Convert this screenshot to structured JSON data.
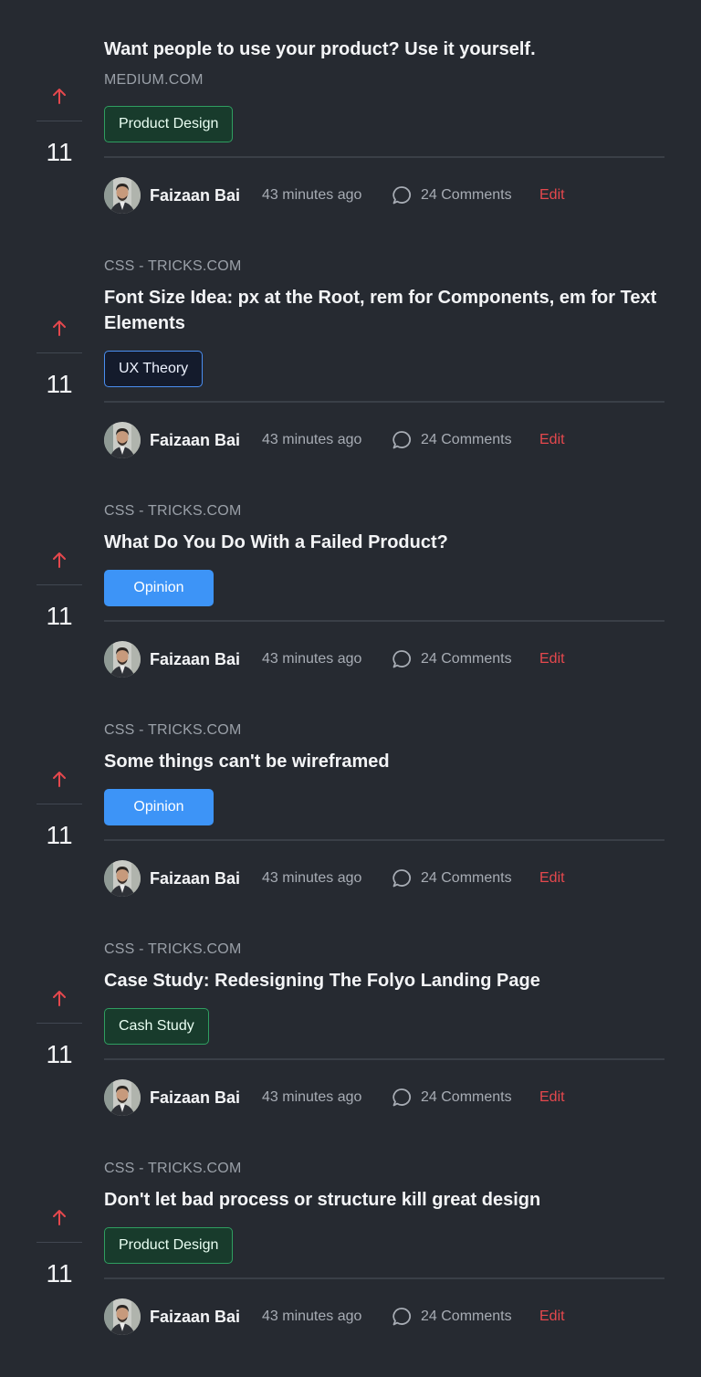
{
  "posts": [
    {
      "source": "MEDIUM.COM",
      "title": "Want people to use your product? Use it yourself.",
      "tag": "Product Design",
      "votes": "11",
      "author": "Faizaan Bai",
      "time": "43 minutes ago",
      "comments": "24 Comments",
      "edit": "Edit"
    },
    {
      "source": "CSS - TRICKS.COM",
      "title": "Font Size Idea: px at the Root, rem for Components, em for Text Elements",
      "tag": "UX Theory",
      "votes": "11",
      "author": "Faizaan Bai",
      "time": "43 minutes ago",
      "comments": "24 Comments",
      "edit": "Edit"
    },
    {
      "source": "CSS - TRICKS.COM",
      "title": "What Do You Do With a Failed Product?",
      "tag": "Opinion",
      "votes": "11",
      "author": "Faizaan Bai",
      "time": "43 minutes ago",
      "comments": "24 Comments",
      "edit": "Edit"
    },
    {
      "source": "CSS - TRICKS.COM",
      "title": "Some things can't be wireframed",
      "tag": "Opinion",
      "votes": "11",
      "author": "Faizaan Bai",
      "time": "43 minutes ago",
      "comments": "24 Comments",
      "edit": "Edit"
    },
    {
      "source": "CSS - TRICKS.COM",
      "title": "Case Study: Redesigning The Folyo Landing Page",
      "tag": "Cash Study",
      "votes": "11",
      "author": "Faizaan Bai",
      "time": "43 minutes ago",
      "comments": "24 Comments",
      "edit": "Edit"
    },
    {
      "source": "CSS - TRICKS.COM",
      "title": "Don't let bad process or structure kill great design",
      "tag": "Product Design",
      "votes": "11",
      "author": "Faizaan Bai",
      "time": "43 minutes ago",
      "comments": "24 Comments",
      "edit": "Edit"
    }
  ],
  "icons": {
    "upvote": "arrow-up-icon",
    "comments": "chat-bubble-icon",
    "avatar": "user-avatar"
  },
  "colors": {
    "background": "#262a31",
    "upvote": "#e5484d",
    "edit": "#e5484d",
    "tag_green": "#2f9e60",
    "tag_navy": "#4a8ef0",
    "tag_blue": "#3d94f7"
  }
}
